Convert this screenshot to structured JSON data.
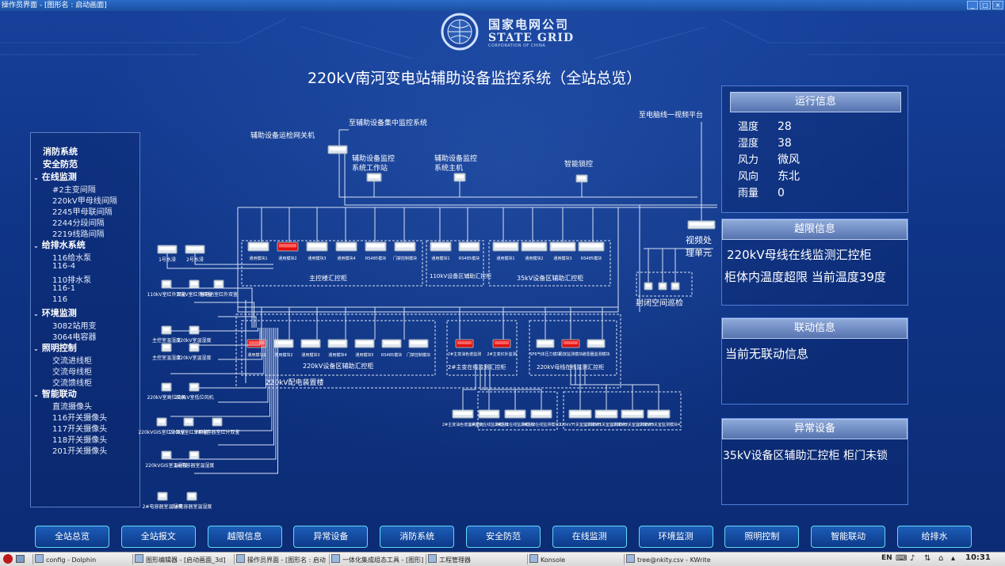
{
  "window": {
    "title": "操作员界面 - [图形名 : 启动画面]"
  },
  "logo": {
    "cn": "国家电网公司",
    "en": "STATE GRID",
    "sub": "CORPORATION OF CHINA",
    "ring": "STATE GRID CORPORATION OF CHINA"
  },
  "main_title": "220kV南河变电站辅助设备监控系统（全站总览）",
  "left_nav": [
    {
      "label": "消防系统",
      "level": 1,
      "arrow": false
    },
    {
      "label": "安全防范",
      "level": 1,
      "arrow": false
    },
    {
      "label": "在线监测",
      "level": 1,
      "arrow": true
    },
    {
      "label": "#2主变间隔",
      "level": 2
    },
    {
      "label": "220kV甲母线间隔",
      "level": 2
    },
    {
      "label": "2245甲母联间隔",
      "level": 2
    },
    {
      "label": "2244分段间隔",
      "level": 2
    },
    {
      "label": "2219线路间隔",
      "level": 2
    },
    {
      "label": "给排水系统",
      "level": 1,
      "arrow": true
    },
    {
      "label": "116给水泵",
      "level": 2
    },
    {
      "label": "116-4",
      "level": 2
    },
    {
      "label": "110排水泵",
      "level": 2
    },
    {
      "label": "116-1",
      "level": 2
    },
    {
      "label": "116",
      "level": 2
    },
    {
      "label": "环境监测",
      "level": 1,
      "arrow": true
    },
    {
      "label": "3082站用变",
      "level": 2
    },
    {
      "label": "3064电容器",
      "level": 2
    },
    {
      "label": "照明控制",
      "level": 1,
      "arrow": true
    },
    {
      "label": "交流进线柜",
      "level": 2
    },
    {
      "label": "交流母线柜",
      "level": 2
    },
    {
      "label": "交流馈线柜",
      "level": 2
    },
    {
      "label": "智能联动",
      "level": 1,
      "arrow": true
    },
    {
      "label": "直流摄像头",
      "level": 2
    },
    {
      "label": "116开关摄像头",
      "level": 2
    },
    {
      "label": "117开关摄像头",
      "level": 2
    },
    {
      "label": "118开关摄像头",
      "level": 2
    },
    {
      "label": "201开关摄像头",
      "level": 2
    }
  ],
  "diagram": {
    "top_label": "至辅助设备集中监控系统",
    "gateway": "辅助设备运检网关机",
    "workstation": [
      "辅助设备监控",
      "系统工作站"
    ],
    "host": [
      "辅助设备监控",
      "系统主机"
    ],
    "smart_lock": "智能锁控",
    "video_label": "至电脑线一视频平台",
    "video_unit": [
      "视频处",
      "理单元"
    ],
    "closed_space": "封闭空间巡检",
    "pumps": [
      "1号水浸",
      "2号水浸"
    ],
    "cabinet_main": {
      "title": "主控楼汇控柜",
      "modules": [
        "通用模块1",
        "通用模块2",
        "通用模块3",
        "通用模块4",
        "RS485模块",
        "门禁控制模块"
      ]
    },
    "cabinet_110": {
      "title": "110kV设备区辅助汇控柜",
      "modules": [
        "通用模块1",
        "RS485模块"
      ]
    },
    "cabinet_35": {
      "title": "35kV设备区辅助汇控柜",
      "modules": [
        "通用模块1",
        "通用模块2",
        "通用模块3",
        "RS485模块"
      ]
    },
    "cabinet_220": {
      "title": "220kV设备区辅助汇控柜",
      "modules": [
        "通用模块1",
        "通用模块2",
        "通用模块3",
        "通用模块4",
        "通用模块5",
        "RS485模块",
        "门禁控制模块"
      ]
    },
    "cabinet_2zb": {
      "title": "2#主变在线监测汇控柜",
      "modules": [
        "2#主变油色谱监测",
        "2#主变红外监测"
      ]
    },
    "cabinet_220m": {
      "title": "220kV母线在线监测汇控柜",
      "modules": [
        "SF6气体压力模块",
        "局放监测模块",
        "避雷器监测模块"
      ]
    },
    "building": "220kV配电装置楼",
    "left_devices": [
      "110kV室红外双鉴",
      "35kV室红外双鉴",
      "蓄电池室红外双鉴",
      "主控室温湿度",
      "220kV室温湿度",
      "主控室温湿度",
      "220kV室温湿度",
      "220kV室高位风机",
      "220kV室低位风机",
      "220kVGIS室红外双鉴",
      "220kV室红外双鉴",
      "1#电容器室红外双鉴",
      "220kVGIS室温湿度",
      "1#电容器室温湿度",
      "2#电容器室温湿度",
      "3#电容器室温湿度"
    ],
    "bottom_left_devices": [
      "2#主变油色谱监测单元",
      "2#主变在线监测模块1",
      "2#主变在线监测模块2",
      "2#主变在线监测模块3"
    ],
    "bottom_right_devices": [
      "220kV开关室监测模块1",
      "220kV开关室监测模块2",
      "220kV开关室监测模块3",
      "220kV开关室监测模块4"
    ]
  },
  "run_info": {
    "title": "运行信息",
    "rows": [
      {
        "label": "温度",
        "value": "28"
      },
      {
        "label": "湿度",
        "value": "38"
      },
      {
        "label": "风力",
        "value": "微风"
      },
      {
        "label": "风向",
        "value": "东北"
      },
      {
        "label": "雨量",
        "value": "0"
      }
    ]
  },
  "limit_info": {
    "title": "越限信息",
    "line1": "220kV母线在线监测汇控柜",
    "line2": "柜体内温度超限 当前温度39度"
  },
  "linkage_info": {
    "title": "联动信息",
    "line1": "当前无联动信息"
  },
  "abnormal": {
    "title": "异常设备",
    "line1": "35kV设备区辅助汇控柜 柜门未锁"
  },
  "bottom_nav": [
    "全站总览",
    "全站报文",
    "越限信息",
    "异常设备",
    "消防系统",
    "安全防范",
    "在线监测",
    "环境监测",
    "照明控制",
    "智能联动",
    "给排水"
  ],
  "taskbar": {
    "tasks": [
      "config - Dolphin",
      "图形编辑器 - [启动画面_3d]",
      "操作员界面 - [图形名 : 启动",
      "一体化集成组态工具 - [图形]",
      "工程管理器",
      "Konsole",
      "tree@nkity.csv - KWrite"
    ],
    "lang": "EN",
    "time": "10:31"
  },
  "colors": {
    "accent": "#62d9f2",
    "bg": "#0d2a6e",
    "alarm": "#e01010"
  }
}
